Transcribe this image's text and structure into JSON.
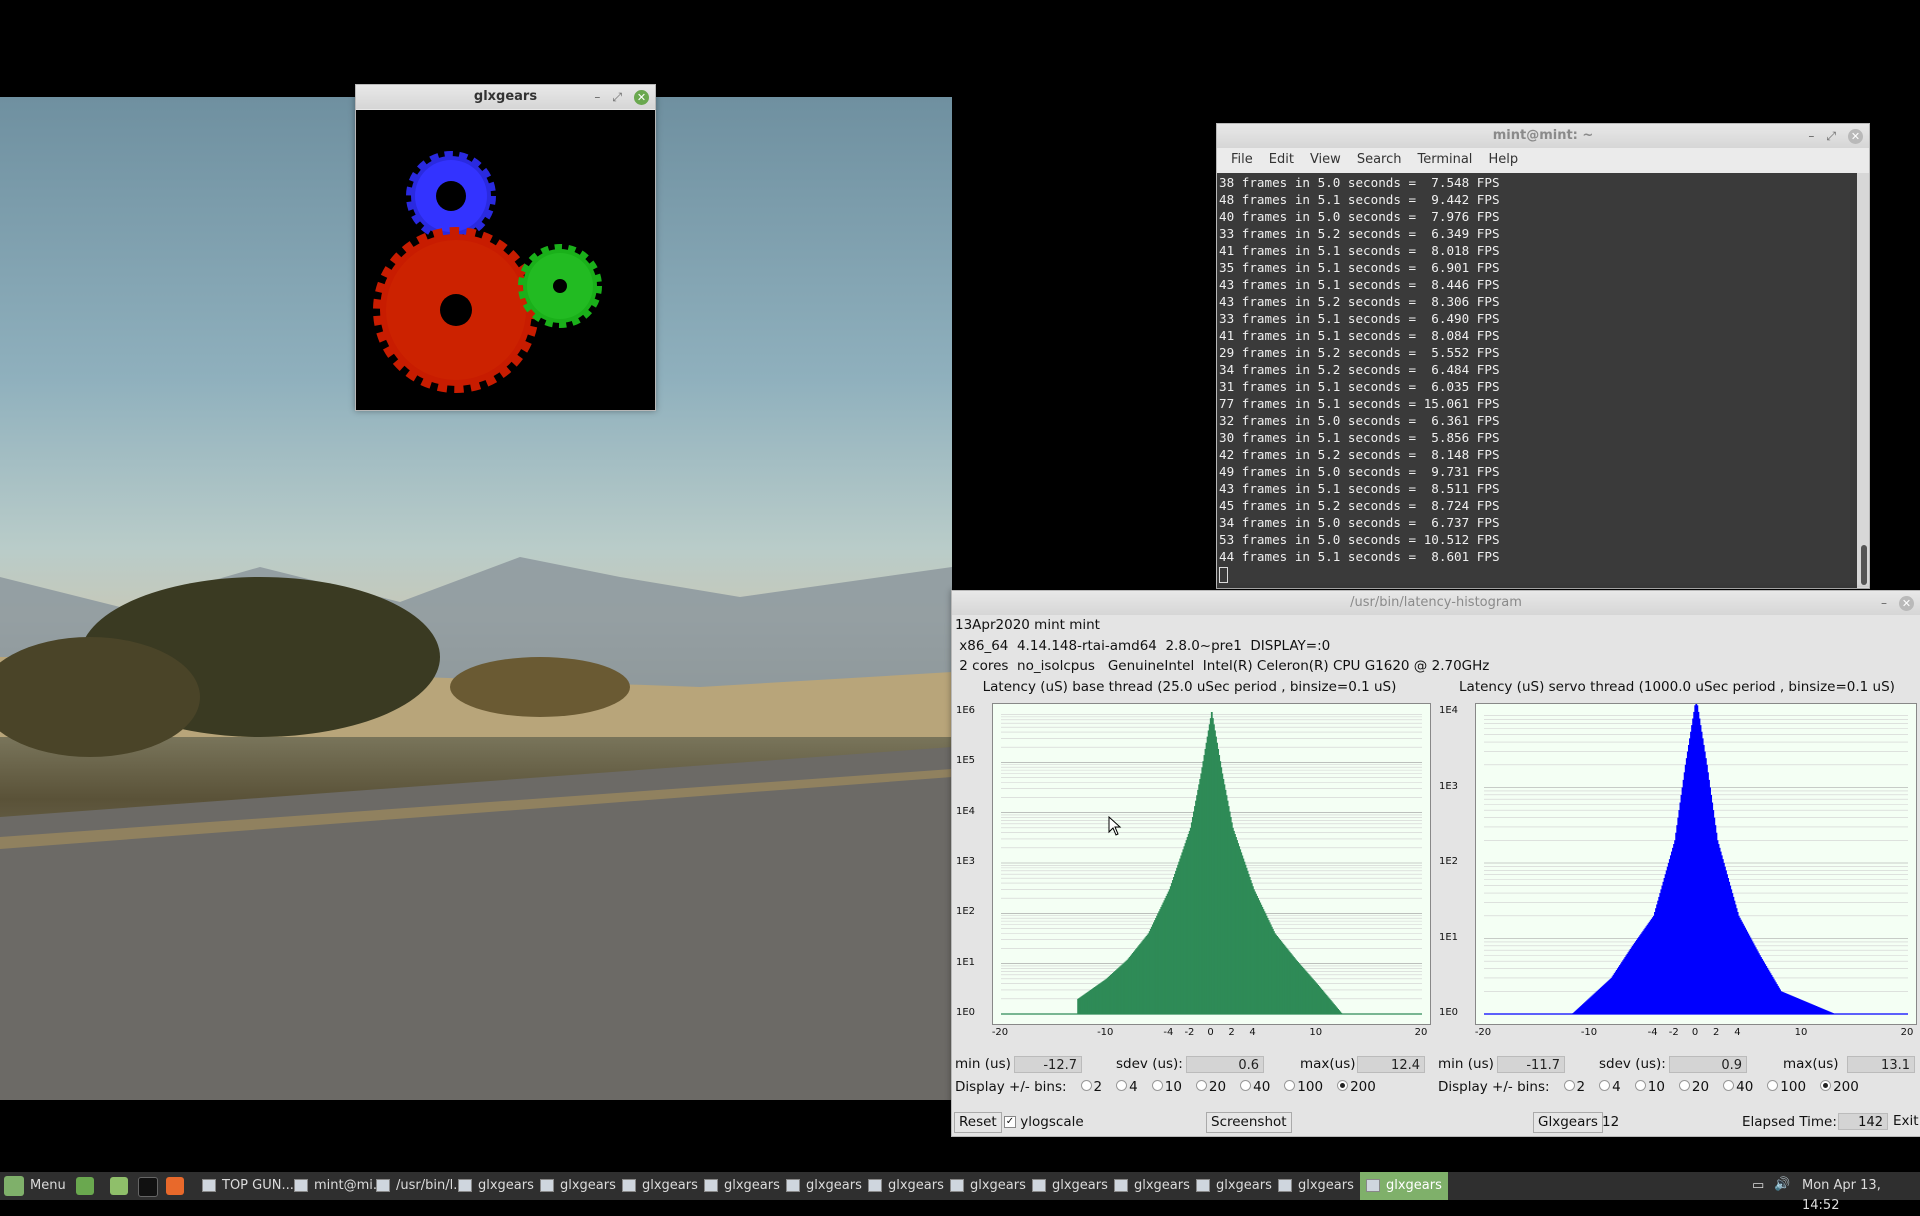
{
  "glxgears_window": {
    "title": "glxgears"
  },
  "terminal": {
    "title": "mint@mint: ~",
    "menu": [
      "File",
      "Edit",
      "View",
      "Search",
      "Terminal",
      "Help"
    ],
    "lines": [
      "38 frames in 5.0 seconds =  7.548 FPS",
      "48 frames in 5.1 seconds =  9.442 FPS",
      "40 frames in 5.0 seconds =  7.976 FPS",
      "33 frames in 5.2 seconds =  6.349 FPS",
      "41 frames in 5.1 seconds =  8.018 FPS",
      "35 frames in 5.1 seconds =  6.901 FPS",
      "43 frames in 5.1 seconds =  8.446 FPS",
      "43 frames in 5.2 seconds =  8.306 FPS",
      "33 frames in 5.1 seconds =  6.490 FPS",
      "41 frames in 5.1 seconds =  8.084 FPS",
      "29 frames in 5.2 seconds =  5.552 FPS",
      "34 frames in 5.2 seconds =  6.484 FPS",
      "31 frames in 5.1 seconds =  6.035 FPS",
      "77 frames in 5.1 seconds = 15.061 FPS",
      "32 frames in 5.0 seconds =  6.361 FPS",
      "30 frames in 5.1 seconds =  5.856 FPS",
      "42 frames in 5.2 seconds =  8.148 FPS",
      "49 frames in 5.0 seconds =  9.731 FPS",
      "43 frames in 5.1 seconds =  8.511 FPS",
      "45 frames in 5.2 seconds =  8.724 FPS",
      "34 frames in 5.0 seconds =  6.737 FPS",
      "53 frames in 5.0 seconds = 10.512 FPS",
      "44 frames in 5.1 seconds =  8.601 FPS"
    ]
  },
  "histogram_window": {
    "title": "/usr/bin/latency-histogram",
    "info": [
      "13Apr2020 mint mint",
      " x86_64  4.14.148-rtai-amd64  2.8.0~pre1  DISPLAY=:0",
      " 2 cores  no_isolcpus   GenuineIntel  Intel(R) Celeron(R) CPU G1620 @ 2.70GHz"
    ],
    "panels": [
      {
        "title": "Latency (uS) base thread (25.0 uSec period , binsize=0.1 uS)",
        "min_label": "min (us)",
        "min": "-12.7",
        "sdev_label": "sdev (us):",
        "sdev": "0.6",
        "max_label": "max(us)",
        "max": "12.4",
        "bins_label": "Display +/- bins:",
        "bins": [
          "2",
          "4",
          "10",
          "20",
          "40",
          "100",
          "200"
        ],
        "bins_selected": "200",
        "color": "#2e8b57"
      },
      {
        "title": "Latency (uS) servo thread (1000.0 uSec period , binsize=0.1 uS)",
        "min_label": "min (us)",
        "min": "-11.7",
        "sdev_label": "sdev (us):",
        "sdev": "0.9",
        "max_label": "max(us)",
        "max": "13.1",
        "bins_label": "Display +/- bins:",
        "bins": [
          "2",
          "4",
          "10",
          "20",
          "40",
          "100",
          "200"
        ],
        "bins_selected": "200",
        "color": "#0000ff"
      }
    ],
    "bottom": {
      "reset": "Reset",
      "ylogscale": "ylogscale",
      "ylogscale_checked": true,
      "screenshot": "Screenshot",
      "glxgears": "Glxgears",
      "glxgears_count": "12",
      "elapsed_label": "Elapsed Time:",
      "elapsed": "142",
      "exit": "Exit"
    }
  },
  "chart_data": [
    {
      "type": "bar",
      "title": "Latency (uS) base thread (25.0 uSec period , binsize=0.1 uS)",
      "y_scale": "log",
      "ylim_ticks": [
        "1E0",
        "1E1",
        "1E2",
        "1E3",
        "1E4",
        "1E5",
        "1E6"
      ],
      "xlim": [
        -20,
        20
      ],
      "x_ticks": [
        -20,
        -10,
        -4,
        -2,
        0,
        2,
        4,
        10,
        20
      ],
      "x": [
        -12.7,
        -10,
        -8,
        -6,
        -4,
        -2,
        -1,
        0,
        1,
        2,
        4,
        6,
        8,
        10,
        12.4
      ],
      "values": [
        2,
        5,
        12,
        40,
        300,
        5000,
        60000,
        1000000,
        60000,
        5000,
        300,
        40,
        12,
        4,
        1
      ],
      "legend": "none",
      "color": "#2e8b57"
    },
    {
      "type": "bar",
      "title": "Latency (uS) servo thread (1000.0 uSec period , binsize=0.1 uS)",
      "y_scale": "log",
      "ylim_ticks": [
        "1E0",
        "1E1",
        "1E2",
        "1E3",
        "1E4"
      ],
      "xlim": [
        -20,
        20
      ],
      "x_ticks": [
        -20,
        -10,
        -4,
        -2,
        0,
        2,
        4,
        10,
        20
      ],
      "x": [
        -11.7,
        -8,
        -6,
        -4,
        -2,
        -1,
        0,
        1,
        2,
        4,
        6,
        8,
        13.1
      ],
      "values": [
        1,
        3,
        8,
        20,
        200,
        2000,
        15000,
        2000,
        200,
        20,
        6,
        2,
        1
      ],
      "legend": "none",
      "color": "#0000ff"
    }
  ],
  "taskbar": {
    "menu_label": "Menu",
    "tasks": [
      "TOP GUN...",
      "mint@mi...",
      "/usr/bin/l...",
      "glxgears",
      "glxgears",
      "glxgears",
      "glxgears",
      "glxgears",
      "glxgears",
      "glxgears",
      "glxgears",
      "glxgears",
      "glxgears",
      "glxgears",
      "glxgears"
    ],
    "clock": "Mon Apr 13, 14:52"
  }
}
